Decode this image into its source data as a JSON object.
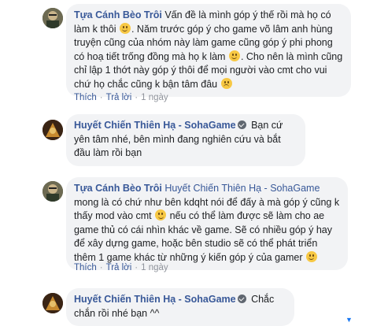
{
  "comments": [
    {
      "author": "Tựa Cánh Bèo Trôi",
      "text_1": " Vấn đề là mình góp ý thế rồi mà họ có làm k thôi ",
      "text_2": ". Năm trước góp ý cho game võ lâm anh hùng truyện cũng của nhóm này làm game cũng góp ý phi phong có hoạ tiết trống đồng mà họ k làm ",
      "text_3": ". Cho nên là mình cũng chỉ lập 1 thớt này góp ý thôi để mọi người vào cmt cho vui chứ họ chắc cũng k bận tâm đâu ",
      "like": "Thích",
      "reply": "Trả lời",
      "time": "1 ngày"
    },
    {
      "author": "Huyết Chiến Thiên Hạ - SohaGame",
      "text": " Bạn cứ yên tâm nhé, bên mình đang nghiên cứu và bắt đầu làm rồi bạn"
    },
    {
      "author": "Tựa Cánh Bèo Trôi",
      "mention": "Huyết Chiến Thiên Hạ - SohaGame",
      "text_1": "mong là có chứ như bên kdqht nói để đấy à mà góp ý cũng k thấy mod vào cmt ",
      "text_2": " nếu có thể làm được sẽ làm cho ae game thủ có cái nhìn khác về game. Sẽ có nhiều góp ý hay để xây dựng game, hoặc bên studio sẽ có thể phát triển thêm 1 game khác từ những ý kiến góp ý của gamer ",
      "like": "Thích",
      "reply": "Trả lời",
      "time": "1 ngày"
    },
    {
      "author": "Huyết Chiến Thiên Hạ - SohaGame",
      "text": " Chắc chắn rồi nhé bạn ^^"
    }
  ],
  "colors": {
    "link": "#385898",
    "bubble": "#f2f3f5",
    "meta": "#90949c"
  }
}
